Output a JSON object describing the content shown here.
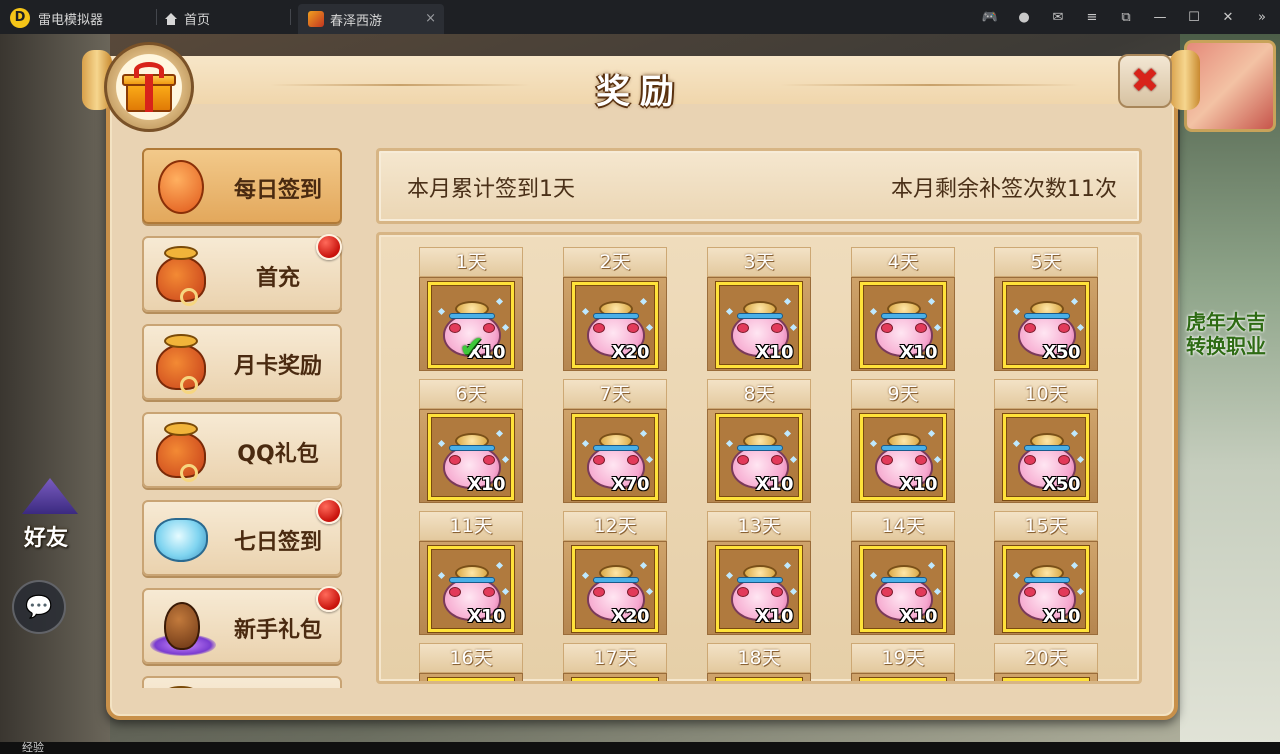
{
  "titlebar": {
    "app_name": "雷电模拟器",
    "home_tab": "首页",
    "game_tab": "春泽西游",
    "tab_close": "×",
    "controls": [
      {
        "name": "gamepad-icon",
        "glyph": "🎮"
      },
      {
        "name": "account-icon",
        "glyph": "●"
      },
      {
        "name": "mail-icon",
        "glyph": "✉"
      },
      {
        "name": "menu-icon",
        "glyph": "≡"
      },
      {
        "name": "popout-icon",
        "glyph": "⧉"
      },
      {
        "name": "minimize-icon",
        "glyph": "—"
      },
      {
        "name": "maximize-icon",
        "glyph": "☐"
      },
      {
        "name": "close-window-icon",
        "glyph": "✕"
      },
      {
        "name": "sidebar-toggle-icon",
        "glyph": "»"
      }
    ]
  },
  "hud": {
    "banner_line1": "虎年大吉",
    "banner_line2": "转换职业",
    "friend": "好友",
    "chat_icon": "💬",
    "exp": "经验"
  },
  "dialog": {
    "title": "奖励",
    "close_glyph": "✖"
  },
  "sidebar": {
    "items": [
      {
        "label": "每日签到",
        "icon": "lantern",
        "active": true,
        "dot": false
      },
      {
        "label": "首充",
        "icon": "bag",
        "active": false,
        "dot": true
      },
      {
        "label": "月卡奖励",
        "icon": "bag",
        "active": false,
        "dot": false
      },
      {
        "label": "QQ礼包",
        "icon": "bag",
        "active": false,
        "dot": false
      },
      {
        "label": "七日签到",
        "icon": "crystal",
        "active": false,
        "dot": true
      },
      {
        "label": "新手礼包",
        "icon": "egg",
        "active": false,
        "dot": true
      },
      {
        "label": "",
        "icon": "bag",
        "active": false,
        "dot": false
      }
    ]
  },
  "info": {
    "monthly_signed": "本月累计签到1天",
    "remaining_makeups": "本月剩余补签次数11次"
  },
  "calendar": {
    "days": [
      {
        "label": "1天",
        "qty": "X10",
        "signed": true
      },
      {
        "label": "2天",
        "qty": "X20",
        "signed": false
      },
      {
        "label": "3天",
        "qty": "X10",
        "signed": false
      },
      {
        "label": "4天",
        "qty": "X10",
        "signed": false
      },
      {
        "label": "5天",
        "qty": "X50",
        "signed": false
      },
      {
        "label": "6天",
        "qty": "X10",
        "signed": false
      },
      {
        "label": "7天",
        "qty": "X70",
        "signed": false
      },
      {
        "label": "8天",
        "qty": "X10",
        "signed": false
      },
      {
        "label": "9天",
        "qty": "X10",
        "signed": false
      },
      {
        "label": "10天",
        "qty": "X50",
        "signed": false
      },
      {
        "label": "11天",
        "qty": "X10",
        "signed": false
      },
      {
        "label": "12天",
        "qty": "X20",
        "signed": false
      },
      {
        "label": "13天",
        "qty": "X10",
        "signed": false
      },
      {
        "label": "14天",
        "qty": "X10",
        "signed": false
      },
      {
        "label": "15天",
        "qty": "X10",
        "signed": false
      },
      {
        "label": "16天",
        "qty": "",
        "signed": false
      },
      {
        "label": "17天",
        "qty": "",
        "signed": false
      },
      {
        "label": "18天",
        "qty": "",
        "signed": false
      },
      {
        "label": "19天",
        "qty": "",
        "signed": false
      },
      {
        "label": "20天",
        "qty": "",
        "signed": false
      }
    ]
  },
  "colors": {
    "accent_red": "#d8231a",
    "frame_gold": "#ffe23a",
    "panel_beige": "#e9d3b3"
  }
}
